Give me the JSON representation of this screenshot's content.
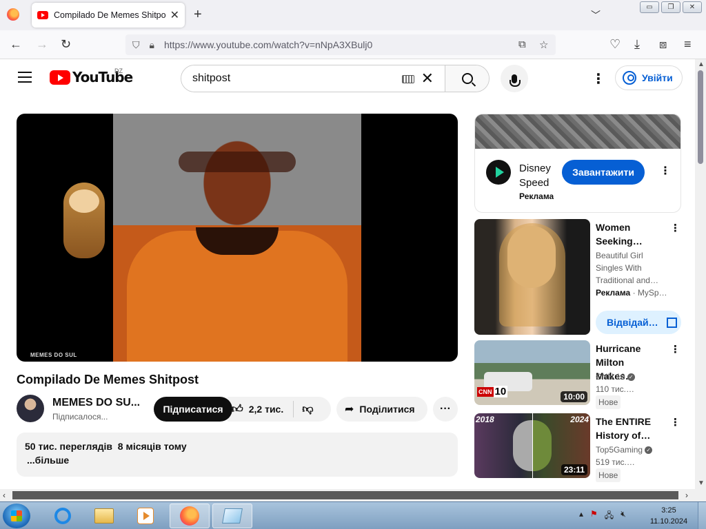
{
  "browser": {
    "tab_title": "Compilado De Memes Shitpost",
    "url": "https://www.youtube.com/watch?v=nNpA3XBulj0",
    "new_tab": "+",
    "close": "✕"
  },
  "youtube": {
    "logo_text": "YouTube",
    "country_code": "DZ",
    "search_value": "shitpost",
    "sign_in": "Увійти"
  },
  "video": {
    "watermark": "MEMES DO SUL",
    "title": "Compilado De Memes Shitpost",
    "channel_name": "MEMES DO SU...",
    "channel_subs": "Підписалося...",
    "subscribe": "Підписатися",
    "likes": "2,2 тис.",
    "share": "Поділитися",
    "views": "50 тис. переглядів",
    "age": "8 місяців тому",
    "more": "...більше"
  },
  "sidebar": {
    "ad": {
      "title_line1": "Disney",
      "title_line2": "Speed",
      "label": "Реклама",
      "download": "Завантажити"
    },
    "recs": [
      {
        "title_line1": "Women",
        "title_line2": "Seeking…",
        "meta1": "Beautiful Girl",
        "meta2": "Singles With",
        "meta3": "Traditional and…",
        "ad_label": "Реклама",
        "advertiser": "· MySp…",
        "visit": "Відвідай…"
      },
      {
        "title_line1": "Hurricane",
        "title_line2": "Milton Makes…",
        "channel": "CNN 10",
        "views": "110 тис.…",
        "badge": "Нове",
        "duration": "10:00",
        "thumb_logo": "CNN",
        "thumb_number": "10"
      },
      {
        "title_line1": "The ENTIRE",
        "title_line2": "History of…",
        "channel": "Top5Gaming",
        "views": "519 тис.…",
        "badge": "Нове",
        "duration": "23:11",
        "year_left": "2018",
        "year_right": "2024"
      }
    ]
  },
  "taskbar": {
    "time": "3:25",
    "date": "11.10.2024"
  },
  "icons": [
    "firefox-icon",
    "youtube-favicon",
    "back-icon",
    "forward-icon",
    "reload-icon",
    "shield-icon",
    "lock-icon",
    "bookmark-star-icon",
    "pocket-icon",
    "download-icon",
    "extensions-icon",
    "menu-icon",
    "keyboard-icon",
    "clear-icon",
    "search-icon",
    "mic-icon",
    "kebab-icon",
    "user-icon",
    "like-icon",
    "dislike-icon",
    "share-icon",
    "external-link-icon",
    "verified-icon"
  ],
  "colors": {
    "youtube_red": "#ff0000",
    "link_blue": "#065fd4",
    "subscribe_bg": "#0f0f0f",
    "chip_bg": "#f2f2f2"
  }
}
